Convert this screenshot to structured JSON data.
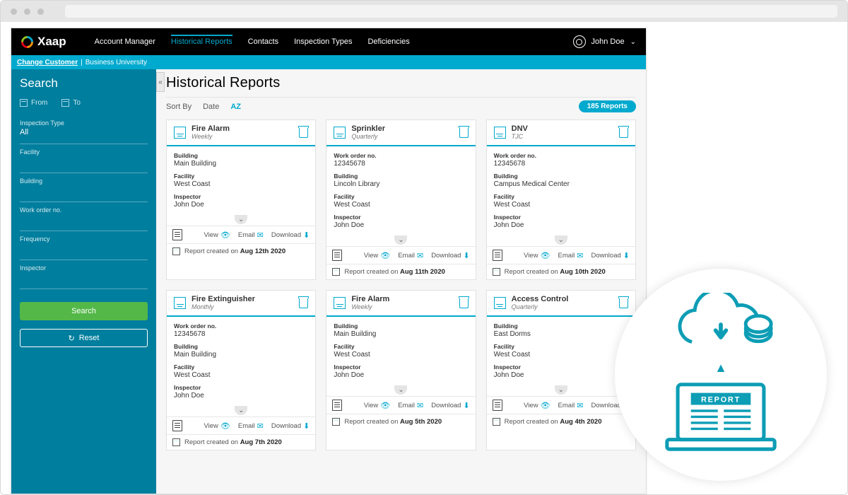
{
  "brand": "Xaap",
  "nav": {
    "items": [
      "Account Manager",
      "Historical Reports",
      "Contacts",
      "Inspection Types",
      "Deficiencies"
    ],
    "active": 1
  },
  "user": {
    "name": "John Doe"
  },
  "customer_bar": {
    "change_label": "Change Customer",
    "customer": "Business University"
  },
  "sidebar": {
    "title": "Search",
    "from": "From",
    "to": "To",
    "fields": [
      {
        "label": "Inspection Type",
        "value": "All"
      },
      {
        "label": "Facility",
        "value": ""
      },
      {
        "label": "Building",
        "value": ""
      },
      {
        "label": "Work order no.",
        "value": ""
      },
      {
        "label": "Frequency",
        "value": ""
      },
      {
        "label": "Inspector",
        "value": ""
      }
    ],
    "search_btn": "Search",
    "reset_btn": "Reset"
  },
  "main": {
    "title": "Historical Reports",
    "sort_by": "Sort By",
    "sort_date": "Date",
    "sort_az": "AZ",
    "count_badge": "185  Reports"
  },
  "labels": {
    "view": "View",
    "email": "Email",
    "download": "Download",
    "created_prefix": "Report created on ",
    "building": "Building",
    "work_order": "Work order no.",
    "facility": "Facility",
    "inspector": "Inspector"
  },
  "cards": [
    {
      "title": "Fire Alarm",
      "freq": "Weekly",
      "fields": [
        [
          "Building",
          "Main Building"
        ],
        [
          "Facility",
          "West Coast"
        ],
        [
          "Inspector",
          "John Doe"
        ]
      ],
      "created": "Aug 12th 2020"
    },
    {
      "title": "Sprinkler",
      "freq": "Quarterly",
      "fields": [
        [
          "Work order no.",
          "12345678"
        ],
        [
          "Building",
          "Lincoln Library"
        ],
        [
          "Facility",
          "West Coast"
        ],
        [
          "Inspector",
          "John Doe"
        ]
      ],
      "created": "Aug 11th 2020"
    },
    {
      "title": "DNV",
      "freq": "TJC",
      "fields": [
        [
          "Work order no.",
          "12345678"
        ],
        [
          "Building",
          "Campus Medical Center"
        ],
        [
          "Facility",
          "West Coast"
        ],
        [
          "Inspector",
          "John Doe"
        ]
      ],
      "created": "Aug 10th 2020"
    },
    {
      "title": "Fire Extinguisher",
      "freq": "Monthly",
      "fields": [
        [
          "Work order no.",
          "12345678"
        ],
        [
          "Building",
          "Main Building"
        ],
        [
          "Facility",
          "West Coast"
        ],
        [
          "Inspector",
          "John Doe"
        ]
      ],
      "created": "Aug 7th 2020"
    },
    {
      "title": "Fire Alarm",
      "freq": "Weekly",
      "fields": [
        [
          "Building",
          "Main Building"
        ],
        [
          "Facility",
          "West Coast"
        ],
        [
          "Inspector",
          "John Doe"
        ]
      ],
      "created": "Aug 5th 2020"
    },
    {
      "title": "Access Control",
      "freq": "Quarterly",
      "fields": [
        [
          "Building",
          "East Dorms"
        ],
        [
          "Facility",
          "West Coast"
        ],
        [
          "Inspector",
          "John Doe"
        ]
      ],
      "created": "Aug 4th 2020"
    }
  ],
  "overlay": {
    "report_label": "REPORT"
  }
}
